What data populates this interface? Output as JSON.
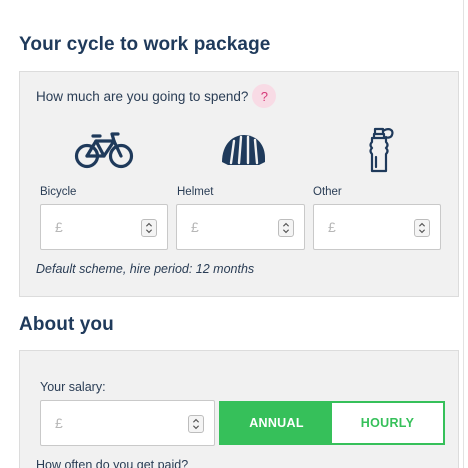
{
  "package": {
    "title": "Your cycle to work package",
    "question": "How much are you going to spend?",
    "help": "?",
    "items": [
      {
        "label": "Bicycle",
        "icon": "bicycle-icon",
        "currency": "£"
      },
      {
        "label": "Helmet",
        "icon": "helmet-icon",
        "currency": "£"
      },
      {
        "label": "Other",
        "icon": "bottle-icon",
        "currency": "£"
      }
    ],
    "note": "Default scheme, hire period: 12 months"
  },
  "about": {
    "title": "About you",
    "salary_label": "Your salary:",
    "salary_currency": "£",
    "toggle": {
      "annual": "ANNUAL",
      "hourly": "HOURLY",
      "selected": "annual"
    },
    "paid_question": "How often do you get paid?"
  },
  "colors": {
    "heading": "#1f3a5b",
    "accent_green": "#36c05a",
    "help_pink": "#d63b79",
    "panel_bg": "#f1f1f1"
  }
}
